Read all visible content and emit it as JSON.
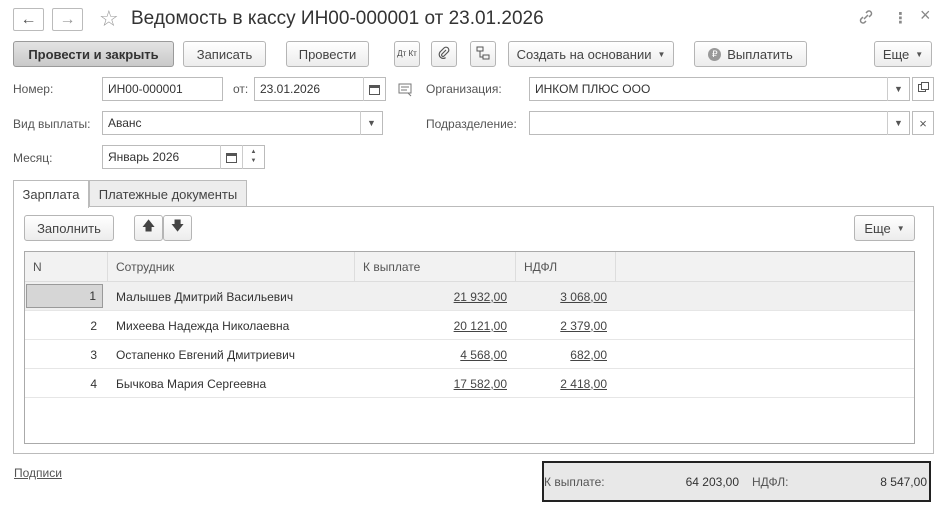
{
  "window": {
    "title": "Ведомость в кассу ИН00-000001 от 23.01.2026",
    "back_icon": "←",
    "forward_icon": "→",
    "star_icon": "☆",
    "link_icon": "🔗",
    "more_icon": "⋮",
    "close_icon": "×"
  },
  "toolbar": {
    "post_close": "Провести и закрыть",
    "save": "Записать",
    "post": "Провести",
    "dtkt": "Дт Кт",
    "create_based": "Создать на основании",
    "pay": "Выплатить",
    "more": "Еще"
  },
  "form": {
    "number_label": "Номер:",
    "number_value": "ИН00-000001",
    "date_label": "от:",
    "date_value": "23.01.2026",
    "org_label": "Организация:",
    "org_value": "ИНКОМ ПЛЮС ООО",
    "paytype_label": "Вид выплаты:",
    "paytype_value": "Аванс",
    "dept_label": "Подразделение:",
    "dept_value": "",
    "month_label": "Месяц:",
    "month_value": "Январь 2026"
  },
  "tabs": [
    {
      "label": "Зарплата"
    },
    {
      "label": "Платежные документы"
    }
  ],
  "table_toolbar": {
    "fill": "Заполнить",
    "more": "Еще"
  },
  "table": {
    "columns": [
      "N",
      "Сотрудник",
      "К выплате",
      "НДФЛ"
    ],
    "rows": [
      {
        "n": "1",
        "employee": "Малышев Дмитрий Васильевич",
        "pay": "21 932,00",
        "ndfl": "3 068,00"
      },
      {
        "n": "2",
        "employee": "Михеева Надежда Николаевна",
        "pay": "20 121,00",
        "ndfl": "2 379,00"
      },
      {
        "n": "3",
        "employee": "Остапенко Евгений Дмитриевич",
        "pay": "4 568,00",
        "ndfl": "682,00"
      },
      {
        "n": "4",
        "employee": "Бычкова Мария Сергеевна",
        "pay": "17 582,00",
        "ndfl": "2 418,00"
      }
    ]
  },
  "footer": {
    "signatures_link": "Подписи",
    "total_pay_label": "К выплате:",
    "total_pay_value": "64 203,00",
    "total_ndfl_label": "НДФЛ:",
    "total_ndfl_value": "8 547,00"
  },
  "colors": {
    "accent": "#333333",
    "selected_row": "#f0f0f0",
    "header_bg": "#f2f2f2"
  }
}
